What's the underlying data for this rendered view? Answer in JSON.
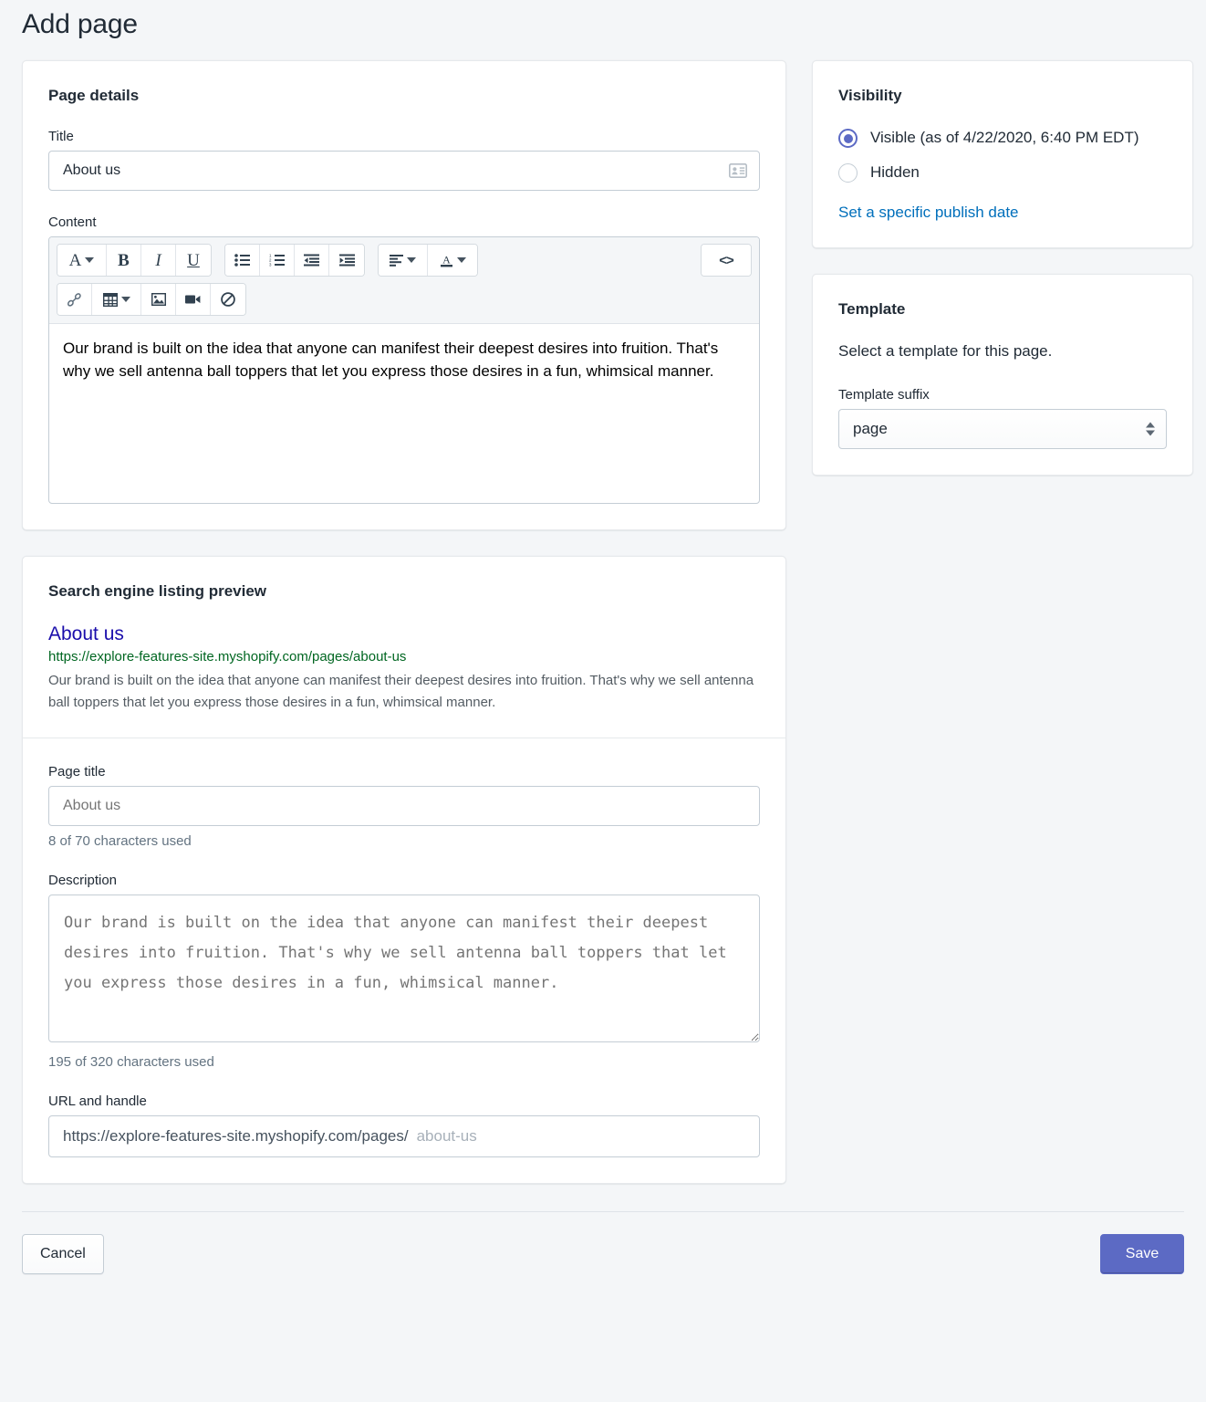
{
  "header": {
    "title": "Add page"
  },
  "page_details": {
    "heading": "Page details",
    "title_label": "Title",
    "title_value": "About us",
    "title_trailing_icon": "contact-card-icon",
    "content_label": "Content",
    "content_value": "Our brand is built on the idea that anyone can manifest their deepest desires into fruition. That's why we sell antenna ball toppers that let you express those desires in a fun, whimsical manner.",
    "toolbar": {
      "row1": [
        {
          "name": "font-family-button",
          "glyph": "A",
          "caret": true
        },
        {
          "name": "bold-button",
          "glyph": "B",
          "caret": false
        },
        {
          "name": "italic-button",
          "glyph": "I",
          "caret": false
        },
        {
          "name": "underline-button",
          "glyph": "U",
          "caret": false
        },
        {
          "name": "bulleted-list-button",
          "glyph": "",
          "caret": false
        },
        {
          "name": "numbered-list-button",
          "glyph": "",
          "caret": false
        },
        {
          "name": "outdent-button",
          "glyph": "",
          "caret": false
        },
        {
          "name": "indent-button",
          "glyph": "",
          "caret": false
        },
        {
          "name": "align-button",
          "glyph": "",
          "caret": true
        },
        {
          "name": "text-color-button",
          "glyph": "",
          "caret": true
        },
        {
          "name": "code-view-button",
          "glyph": "<>",
          "caret": false
        }
      ],
      "row2": [
        {
          "name": "insert-link-button"
        },
        {
          "name": "insert-table-button"
        },
        {
          "name": "insert-image-button"
        },
        {
          "name": "insert-video-button"
        },
        {
          "name": "clear-formatting-button"
        }
      ]
    }
  },
  "seo": {
    "heading": "Search engine listing preview",
    "preview_title": "About us",
    "preview_url": "https://explore-features-site.myshopify.com/pages/about-us",
    "preview_description": "Our brand is built on the idea that anyone can manifest their deepest desires into fruition. That's why we sell antenna ball toppers that let you express those desires in a fun, whimsical manner.",
    "page_title_label": "Page title",
    "page_title_placeholder": "About us",
    "page_title_value": "",
    "page_title_counter": "8 of 70 characters used",
    "description_label": "Description",
    "description_placeholder": "Our brand is built on the idea that anyone can manifest their deepest desires into fruition. That's why we sell antenna ball toppers that let you express those desires in a fun, whimsical manner.",
    "description_value": "",
    "description_counter": "195 of 320 characters used",
    "url_label": "URL and handle",
    "url_prefix": "https://explore-features-site.myshopify.com/pages/",
    "url_handle_placeholder": "about-us"
  },
  "visibility": {
    "heading": "Visibility",
    "options": [
      {
        "label": "Visible (as of 4/22/2020, 6:40 PM EDT)",
        "checked": true
      },
      {
        "label": "Hidden",
        "checked": false
      }
    ],
    "publish_date_link": "Set a specific publish date"
  },
  "template": {
    "heading": "Template",
    "description": "Select a template for this page.",
    "suffix_label": "Template suffix",
    "suffix_value": "page"
  },
  "footer": {
    "cancel_label": "Cancel",
    "save_label": "Save"
  },
  "colors": {
    "accent": "#5c6ac4",
    "link": "#006fbb",
    "seo_title": "#1a0dab",
    "seo_url": "#006621",
    "background": "#f4f6f8"
  }
}
